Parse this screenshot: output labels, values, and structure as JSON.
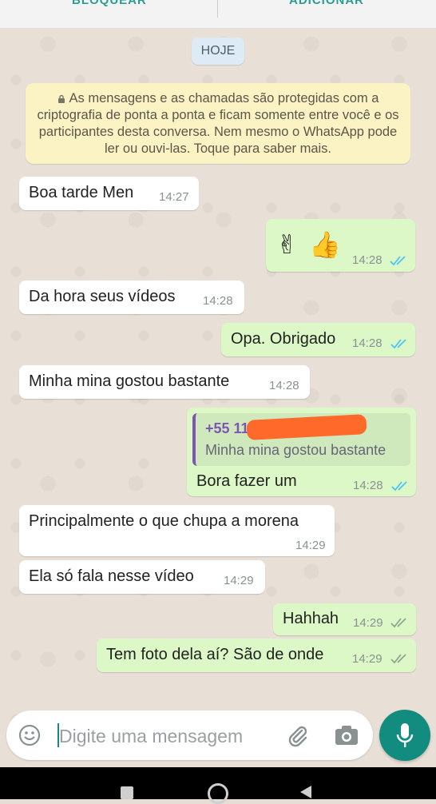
{
  "topbar": {
    "block_label": "BLOQUEAR",
    "add_label": "ADICIONAR"
  },
  "date_chip": "HOJE",
  "encryption_notice": "As mensagens e as chamadas são protegidas com a criptografia de ponta a ponta e ficam somente entre você e os participantes desta conversa. Nem mesmo o WhatsApp pode ler ou ouvi-las. Toque para saber mais.",
  "messages": [
    {
      "direction": "in",
      "text": "Boa tarde Men",
      "time": "14:27"
    },
    {
      "direction": "out",
      "text": "✌🏻👍🏻",
      "time": "14:28",
      "status": "read"
    },
    {
      "direction": "in",
      "text": "Da hora seus vídeos",
      "time": "14:28"
    },
    {
      "direction": "out",
      "text": "Opa. Obrigado",
      "time": "14:28",
      "status": "read"
    },
    {
      "direction": "in",
      "text": "Minha mina gostou bastante",
      "time": "14:28"
    },
    {
      "direction": "out",
      "text": "Bora fazer um",
      "time": "14:28",
      "status": "read",
      "quote": {
        "sender": "+55 11",
        "text": "Minha mina gostou bastante"
      }
    },
    {
      "direction": "in",
      "text": "Principalmente o que chupa a morena",
      "time": "14:29"
    },
    {
      "direction": "in",
      "text": "Ela só fala nesse vídeo",
      "time": "14:29"
    },
    {
      "direction": "out",
      "text": "Hahhah",
      "time": "14:29",
      "status": "delivered"
    },
    {
      "direction": "out",
      "text": "Tem foto dela aí? São de onde",
      "time": "14:29",
      "status": "delivered"
    }
  ],
  "input": {
    "placeholder": "Digite uma mensagem"
  },
  "colors": {
    "accent": "#128c7e",
    "outgoing": "#dcf8c6",
    "incoming": "#ffffff",
    "read_ticks": "#4fc3f7",
    "delivered_ticks": "#92a58c"
  }
}
